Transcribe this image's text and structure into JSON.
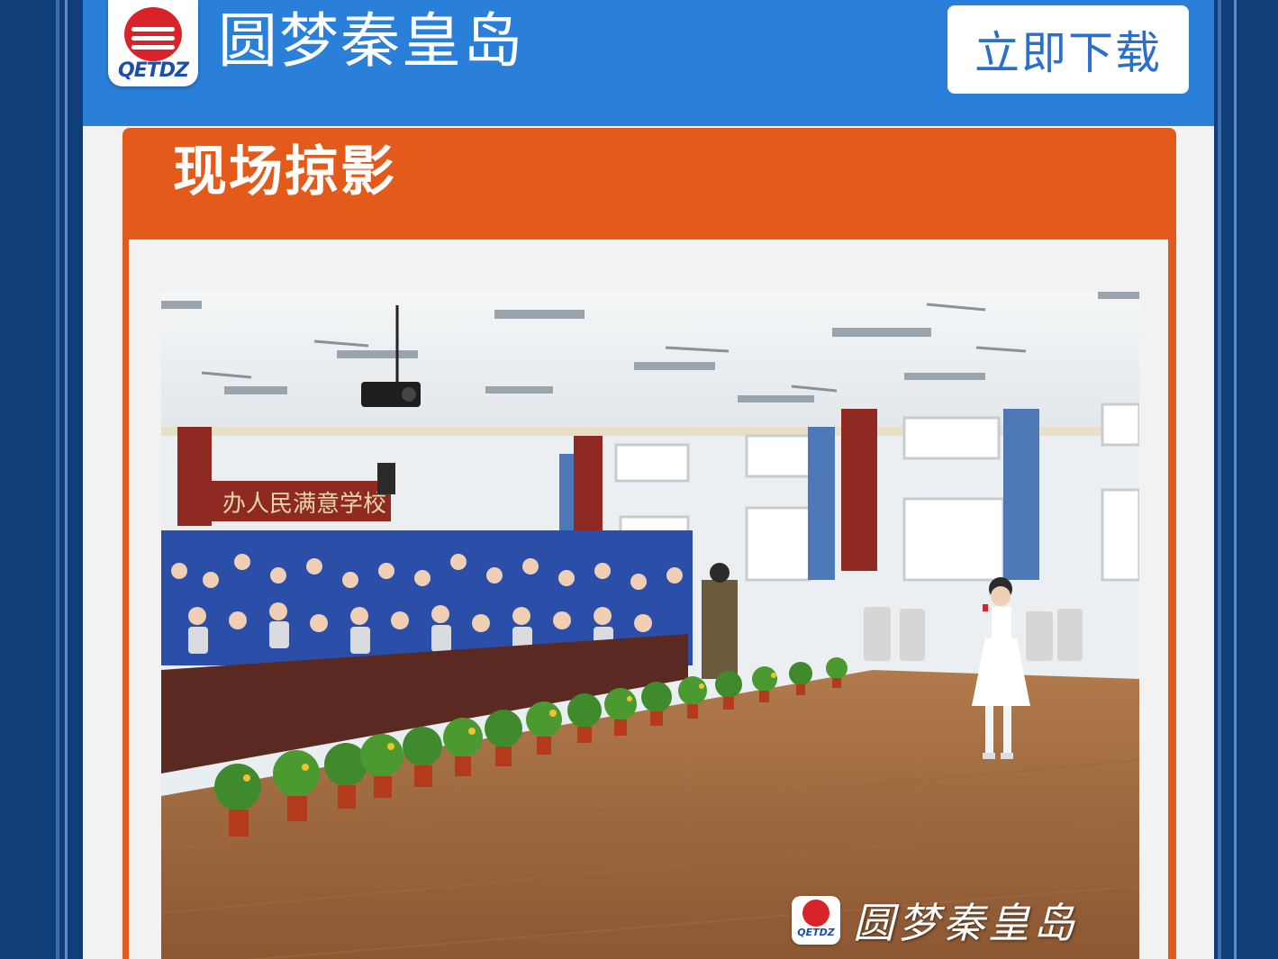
{
  "header": {
    "logo_text": "QETDZ",
    "app_name": "圆梦秦皇岛",
    "download_label": "立即下载"
  },
  "section": {
    "title": "现场掠影"
  },
  "photo": {
    "banner_text": "办人民满意学校",
    "watermark_logo_text": "QETDZ",
    "watermark_text": "圆梦秦皇岛"
  },
  "colors": {
    "page_background": "#0f3e78",
    "header_blue": "#2a7fd8",
    "section_orange": "#e35a1b",
    "logo_red": "#d8232a"
  }
}
